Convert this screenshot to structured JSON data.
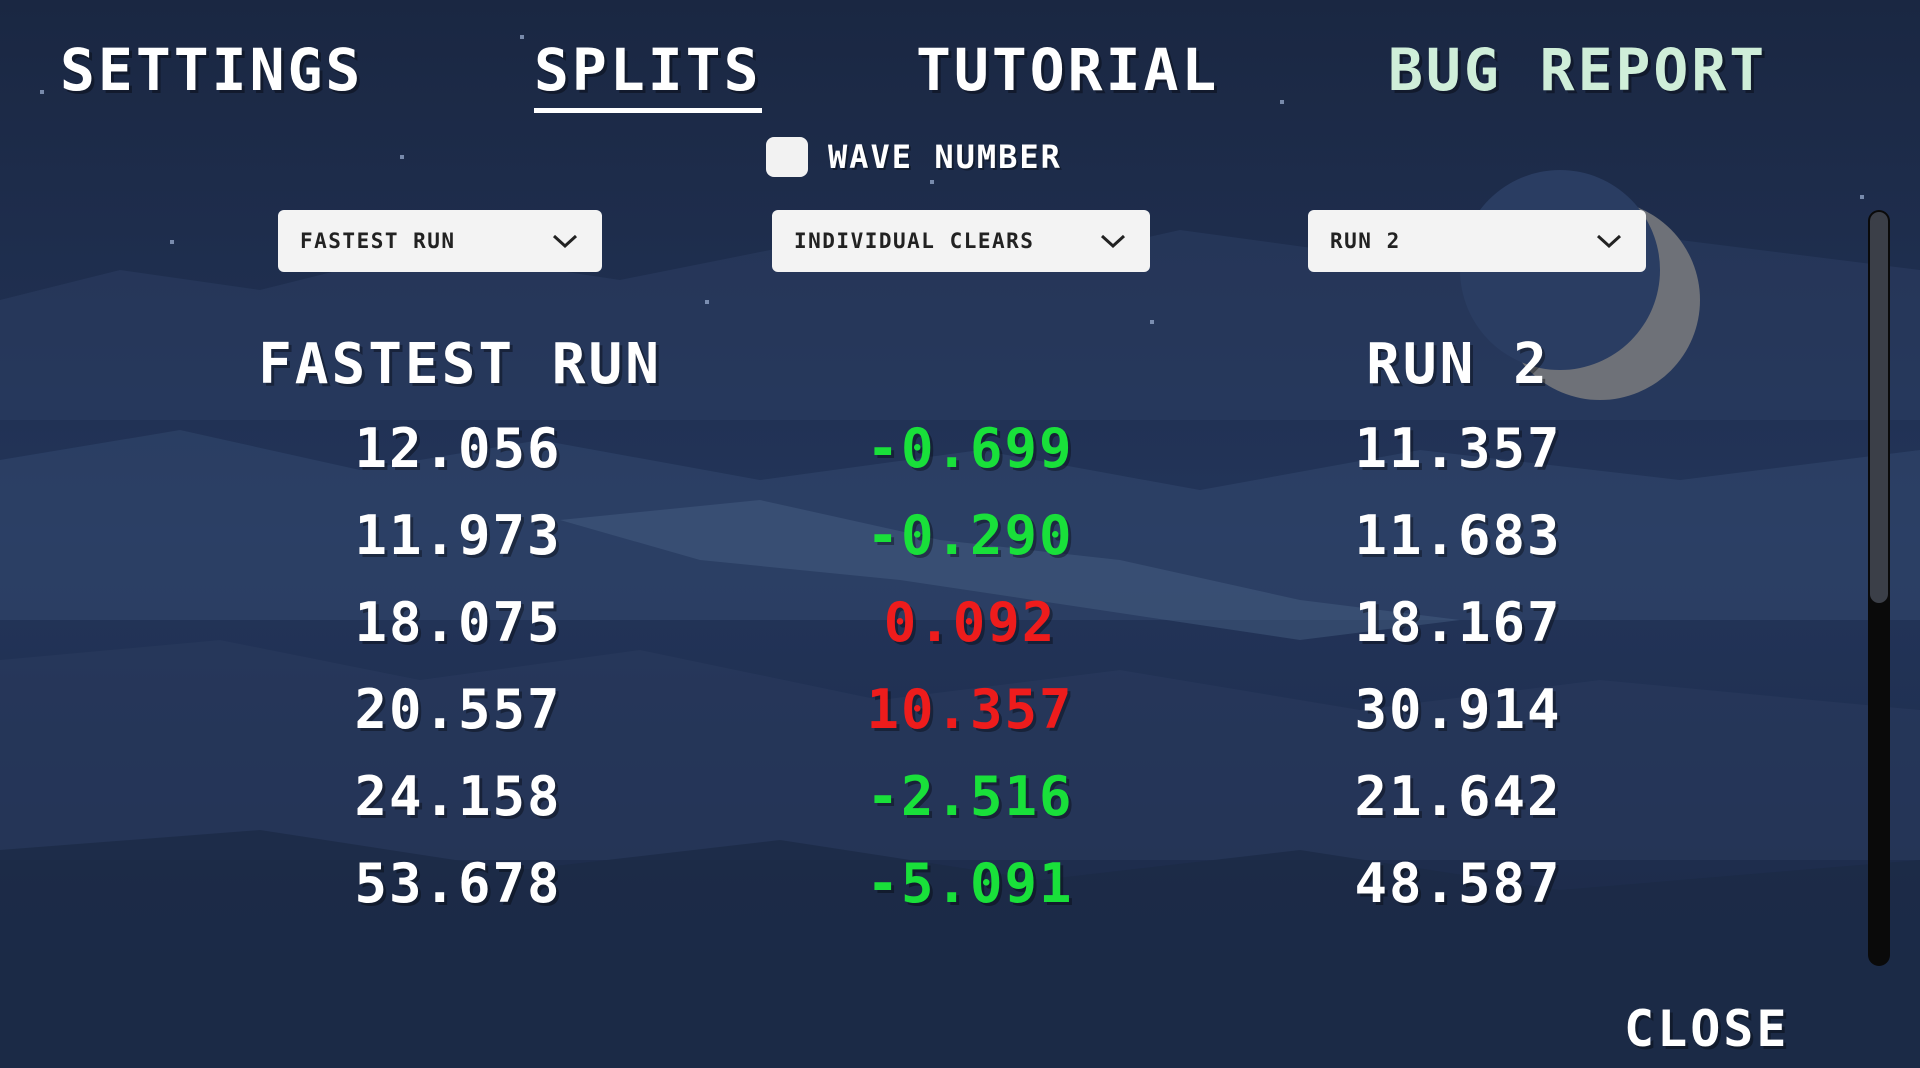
{
  "nav": {
    "tabs": [
      {
        "label": "SETTINGS"
      },
      {
        "label": "SPLITS"
      },
      {
        "label": "TUTORIAL"
      },
      {
        "label": "BUG REPORT"
      }
    ],
    "active_tab": "SPLITS"
  },
  "wave_toggle": {
    "label": "WAVE NUMBER",
    "checked": false
  },
  "dropdowns": {
    "left": {
      "value": "FASTEST RUN"
    },
    "middle": {
      "value": "INDIVIDUAL CLEARS"
    },
    "right": {
      "value": "RUN 2"
    }
  },
  "columns": {
    "left_header": "FASTEST RUN",
    "right_header": "RUN 2"
  },
  "splits": [
    {
      "left": "12.056",
      "diff": "-0.699",
      "right": "11.357",
      "status": "good"
    },
    {
      "left": "11.973",
      "diff": "-0.290",
      "right": "11.683",
      "status": "good"
    },
    {
      "left": "18.075",
      "diff": "0.092",
      "right": "18.167",
      "status": "bad"
    },
    {
      "left": "20.557",
      "diff": "10.357",
      "right": "30.914",
      "status": "bad"
    },
    {
      "left": "24.158",
      "diff": "-2.516",
      "right": "21.642",
      "status": "good"
    },
    {
      "left": "53.678",
      "diff": "-5.091",
      "right": "48.587",
      "status": "good"
    }
  ],
  "scroll": {
    "position_fraction": 0.0,
    "visible_fraction": 0.52
  },
  "close_label": "CLOSE",
  "colors": {
    "good": "#19e03a",
    "bad": "#ee1c1c",
    "accent_tab": "#cfeed9",
    "background": "#1d2b47"
  },
  "icons": {
    "dropdown_chevron": "chevron-down-icon",
    "moon": "crescent-moon-icon"
  }
}
